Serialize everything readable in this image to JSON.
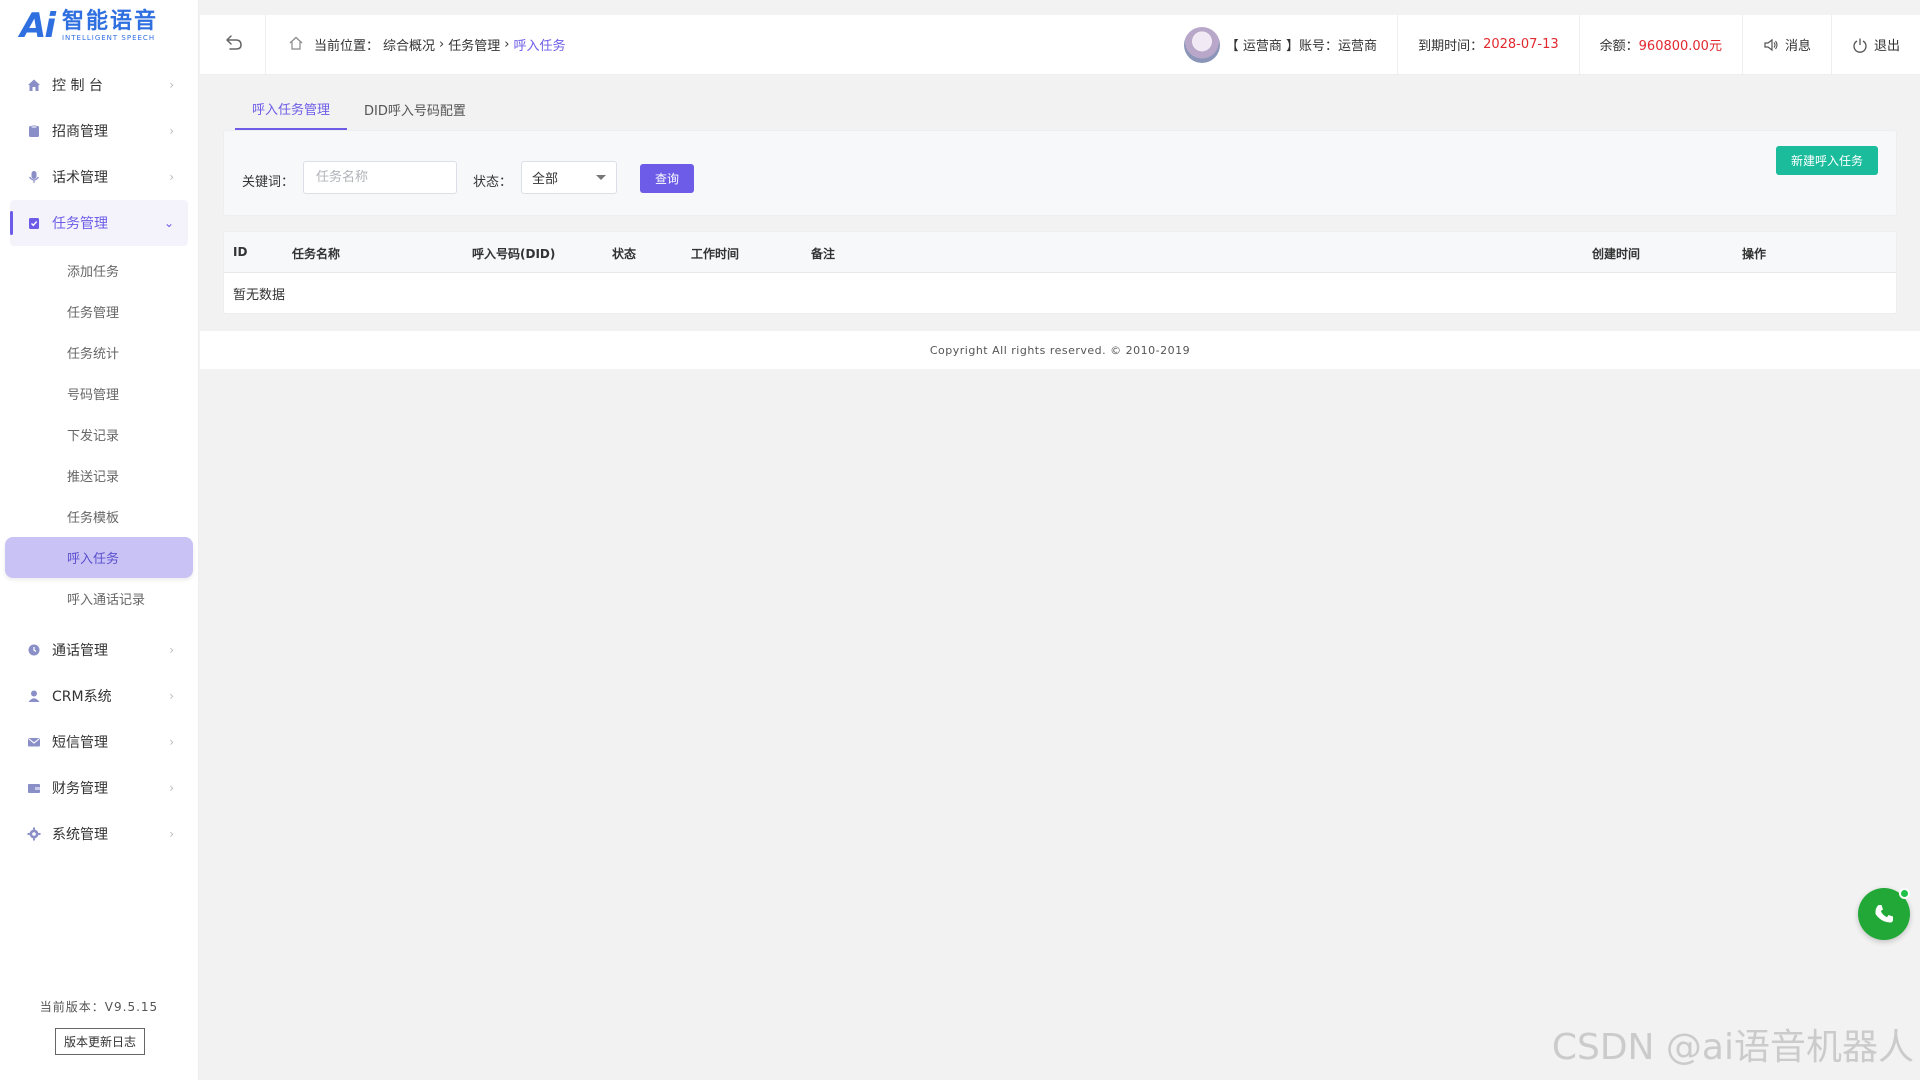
{
  "brand": {
    "logo_mark": "Ai",
    "name_cn": "智能语音",
    "name_en": "INTELLIGENT SPEECH"
  },
  "sidebar": {
    "menu": [
      {
        "label": "控 制 台",
        "icon": "home-icon"
      },
      {
        "label": "招商管理",
        "icon": "clipboard-icon"
      },
      {
        "label": "话术管理",
        "icon": "microphone-icon"
      },
      {
        "label": "任务管理",
        "icon": "task-icon",
        "expanded": true
      },
      {
        "label": "通话管理",
        "icon": "clock-icon"
      },
      {
        "label": "CRM系统",
        "icon": "user-icon"
      },
      {
        "label": "短信管理",
        "icon": "mail-icon"
      },
      {
        "label": "财务管理",
        "icon": "wallet-icon"
      },
      {
        "label": "系统管理",
        "icon": "gear-icon"
      }
    ],
    "submenu": [
      "添加任务",
      "任务管理",
      "任务统计",
      "号码管理",
      "下发记录",
      "推送记录",
      "任务模板",
      "呼入任务",
      "呼入通话记录"
    ],
    "active_submenu": "呼入任务",
    "version": "当前版本：V9.5.15",
    "changelog_label": "版本更新日志"
  },
  "topbar": {
    "breadcrumb_prefix": "当前位置：",
    "crumbs": [
      "综合概况",
      "任务管理",
      "呼入任务"
    ],
    "account": "【 运营商 】账号：运营商",
    "expire_label": "到期时间：",
    "expire_value": "2028-07-13",
    "balance_label": "余额：",
    "balance_value": "960800.00元",
    "message_label": "消息",
    "logout_label": "退出"
  },
  "tabs": [
    "呼入任务管理",
    "DID呼入号码配置"
  ],
  "search": {
    "keyword_label": "关键词：",
    "keyword_placeholder": "任务名称",
    "status_label": "状态：",
    "status_value": "全部",
    "query_label": "查询",
    "new_task_label": "新建呼入任务"
  },
  "table": {
    "columns": [
      "ID",
      "任务名称",
      "呼入号码(DID)",
      "状态",
      "工作时间",
      "备注",
      "创建时间",
      "操作"
    ],
    "empty_text": "暂无数据"
  },
  "footer": {
    "copyright": "Copyright All rights reserved. © 2010-2019"
  },
  "watermark": "CSDN @ai语音机器人",
  "colors": {
    "accent": "#6c5ce7",
    "success": "#1abc9c",
    "danger": "#e0282e",
    "phone": "#21a837"
  }
}
